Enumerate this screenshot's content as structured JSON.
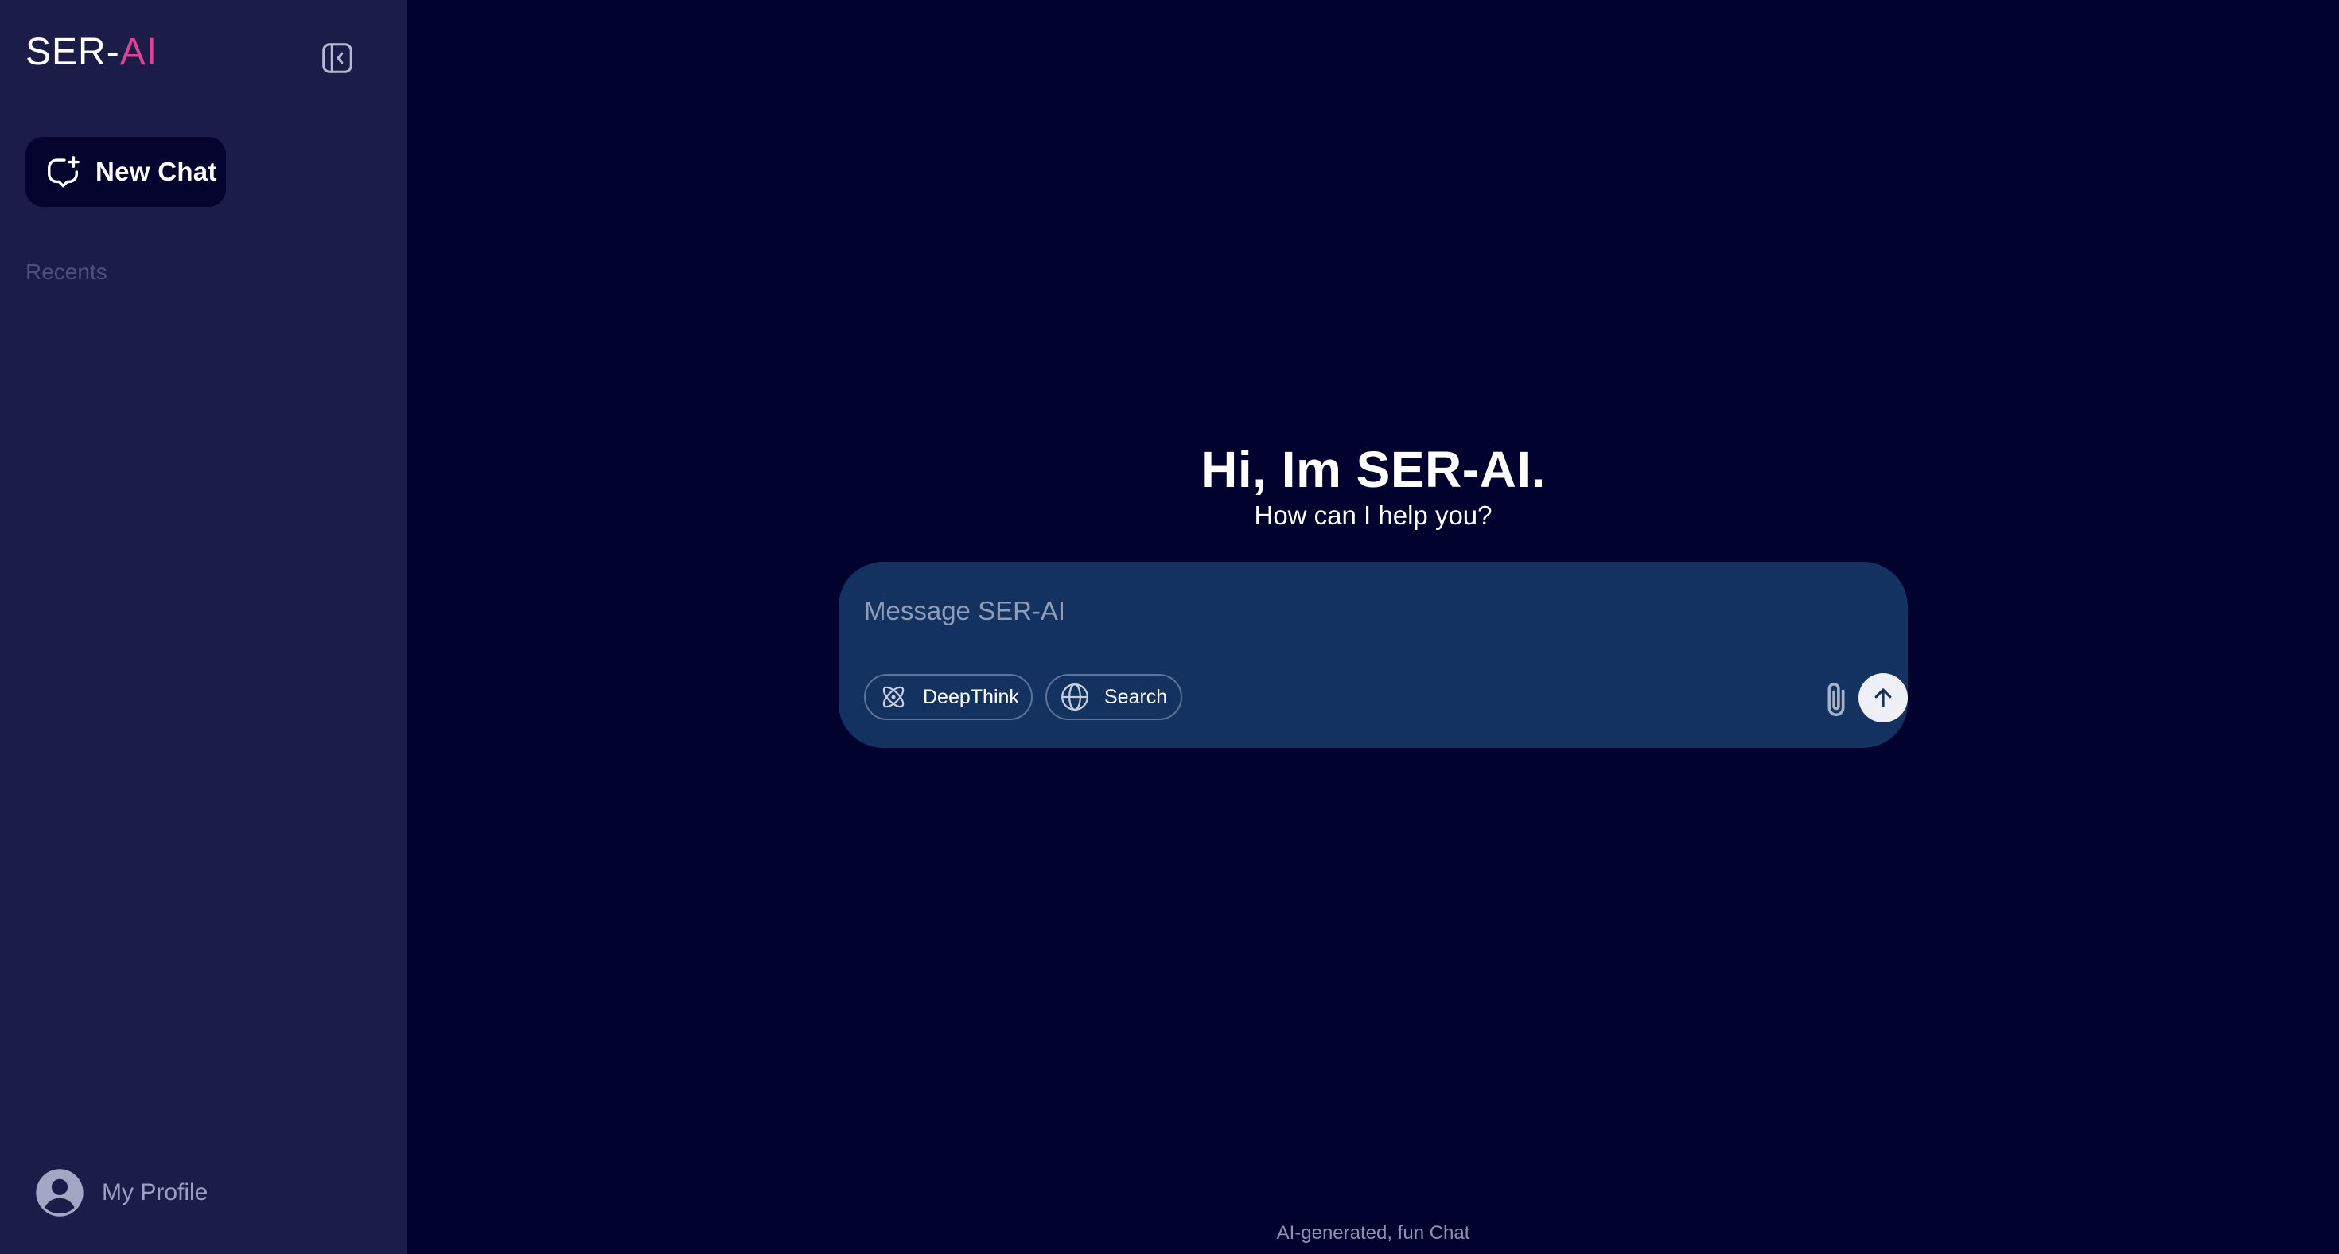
{
  "sidebar": {
    "brand": {
      "prefix": "SER-",
      "accent": "AI"
    },
    "collapse_icon": "sidebar-collapse-icon",
    "new_chat": {
      "label": "New Chat",
      "icon": "new-chat-icon"
    },
    "recents_label": "Recents",
    "profile": {
      "label": "My Profile",
      "icon": "user-avatar-icon"
    }
  },
  "main": {
    "greeting": "Hi, Im SER-AI.",
    "subtitle": "How can I help you?",
    "composer": {
      "placeholder": "Message SER-AI",
      "value": "",
      "deepthink": {
        "label": "DeepThink",
        "icon": "atom-icon"
      },
      "search": {
        "label": "Search",
        "icon": "globe-icon"
      },
      "attach_icon": "paperclip-icon",
      "send_icon": "arrow-up-icon"
    },
    "footer": "AI-generated, fun Chat"
  },
  "colors": {
    "main_bg": "#02022e",
    "sidebar_bg": "#1b1c48",
    "composer_bg": "#13325f",
    "brand_accent": "#e0409a",
    "new_chat_bg": "#04042e"
  }
}
